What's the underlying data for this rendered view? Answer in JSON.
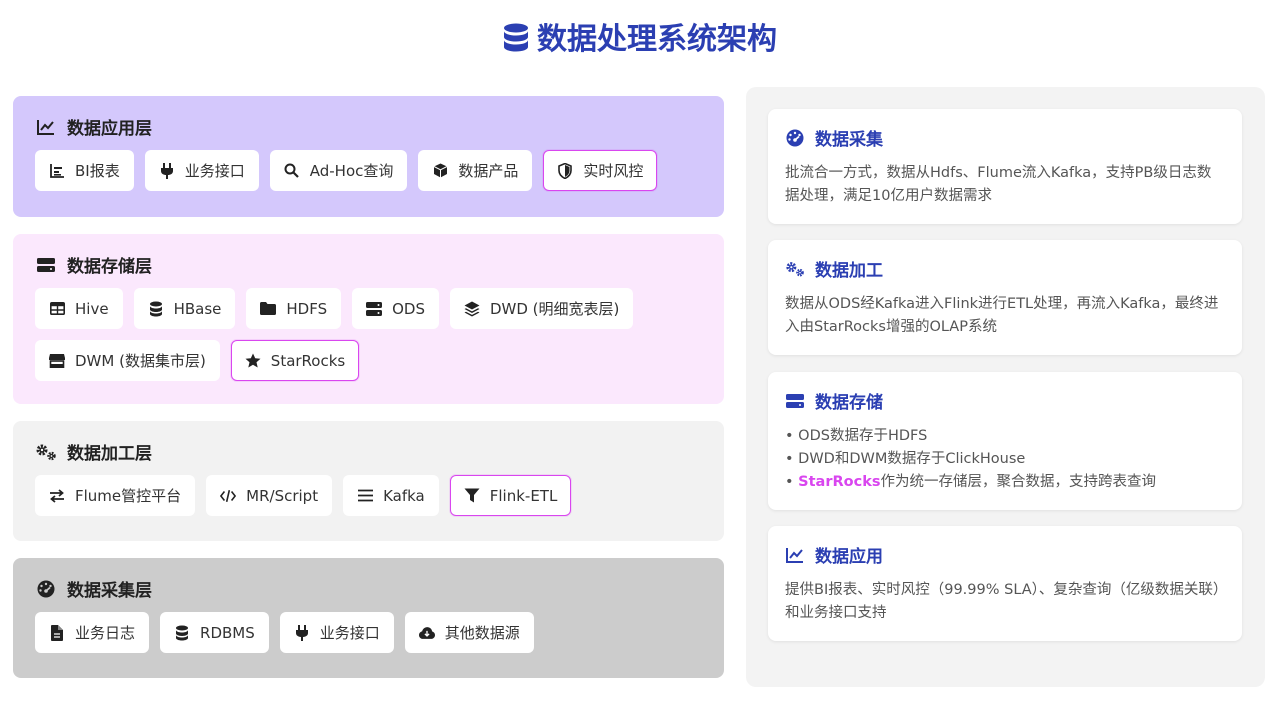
{
  "title": "数据处理系统架构",
  "layers": [
    {
      "title": "数据应用层",
      "icon": "chart-line-icon",
      "chips": [
        {
          "label": "BI报表",
          "icon": "bar-list-icon"
        },
        {
          "label": "业务接口",
          "icon": "plug-icon"
        },
        {
          "label": "Ad-Hoc查询",
          "icon": "search-icon"
        },
        {
          "label": "数据产品",
          "icon": "box-icon"
        },
        {
          "label": "实时风控",
          "icon": "shield-icon",
          "highlight": true
        }
      ]
    },
    {
      "title": "数据存储层",
      "icon": "server-icon",
      "chips": [
        {
          "label": "Hive",
          "icon": "table-icon"
        },
        {
          "label": "HBase",
          "icon": "database-icon"
        },
        {
          "label": "HDFS",
          "icon": "folder-icon"
        },
        {
          "label": "ODS",
          "icon": "server-icon"
        },
        {
          "label": "DWD (明细宽表层)",
          "icon": "layers-icon"
        },
        {
          "label": "DWM (数据集市层)",
          "icon": "store-icon"
        },
        {
          "label": "StarRocks",
          "icon": "star-icon",
          "highlight": true
        }
      ]
    },
    {
      "title": "数据加工层",
      "icon": "gears-icon",
      "chips": [
        {
          "label": "Flume管控平台",
          "icon": "exchange-icon"
        },
        {
          "label": "MR/Script",
          "icon": "code-icon"
        },
        {
          "label": "Kafka",
          "icon": "bars-icon"
        },
        {
          "label": "Flink-ETL",
          "icon": "filter-icon",
          "highlight": true
        }
      ]
    },
    {
      "title": "数据采集层",
      "icon": "gauge-icon",
      "chips": [
        {
          "label": "业务日志",
          "icon": "file-icon"
        },
        {
          "label": "RDBMS",
          "icon": "database-icon"
        },
        {
          "label": "业务接口",
          "icon": "plug-icon"
        },
        {
          "label": "其他数据源",
          "icon": "cloud-download-icon"
        }
      ]
    }
  ],
  "cards": [
    {
      "title": "数据采集",
      "icon": "gauge-icon",
      "text": "批流合一方式，数据从Hdfs、Flume流入Kafka，支持PB级日志数据处理，满足10亿用户数据需求"
    },
    {
      "title": "数据加工",
      "icon": "gears-icon",
      "text": "数据从ODS经Kafka进入Flink进行ETL处理，再流入Kafka，最终进入由StarRocks增强的OLAP系统"
    },
    {
      "title": "数据存储",
      "icon": "server-icon",
      "bullets": [
        {
          "pre": "• ODS数据存于HDFS"
        },
        {
          "pre": "• DWD和DWM数据存于ClickHouse"
        },
        {
          "pre": "• ",
          "strong": "StarRocks",
          "post": "作为统一存储层，聚合数据，支持跨表查询"
        }
      ]
    },
    {
      "title": "数据应用",
      "icon": "chart-line-icon",
      "text": "提供BI报表、实时风控（99.99% SLA）、复杂查询（亿级数据关联）和业务接口支持"
    }
  ]
}
